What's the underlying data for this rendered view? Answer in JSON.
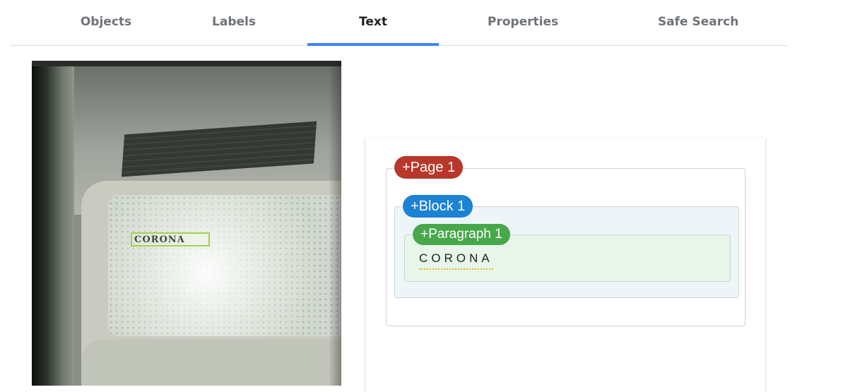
{
  "tabs": [
    {
      "label": "Objects",
      "active": false
    },
    {
      "label": "Labels",
      "active": false
    },
    {
      "label": "Text",
      "active": true
    },
    {
      "label": "Properties",
      "active": false
    },
    {
      "label": "Safe Search",
      "active": false
    }
  ],
  "colors": {
    "tab_indicator": "#4285f4",
    "page_pill": "#b8362a",
    "block_pill": "#1c82d4",
    "paragraph_pill": "#47a84b",
    "block_bg": "#eef5f9",
    "paragraph_bg": "#e7f6e9",
    "bbox_outline": "#a6d24a"
  },
  "image": {
    "detected_text": "CORONA"
  },
  "hierarchy": {
    "page_label": "+Page 1",
    "block_label": "+Block 1",
    "paragraph_label": "+Paragraph 1",
    "word": "CORONA"
  }
}
